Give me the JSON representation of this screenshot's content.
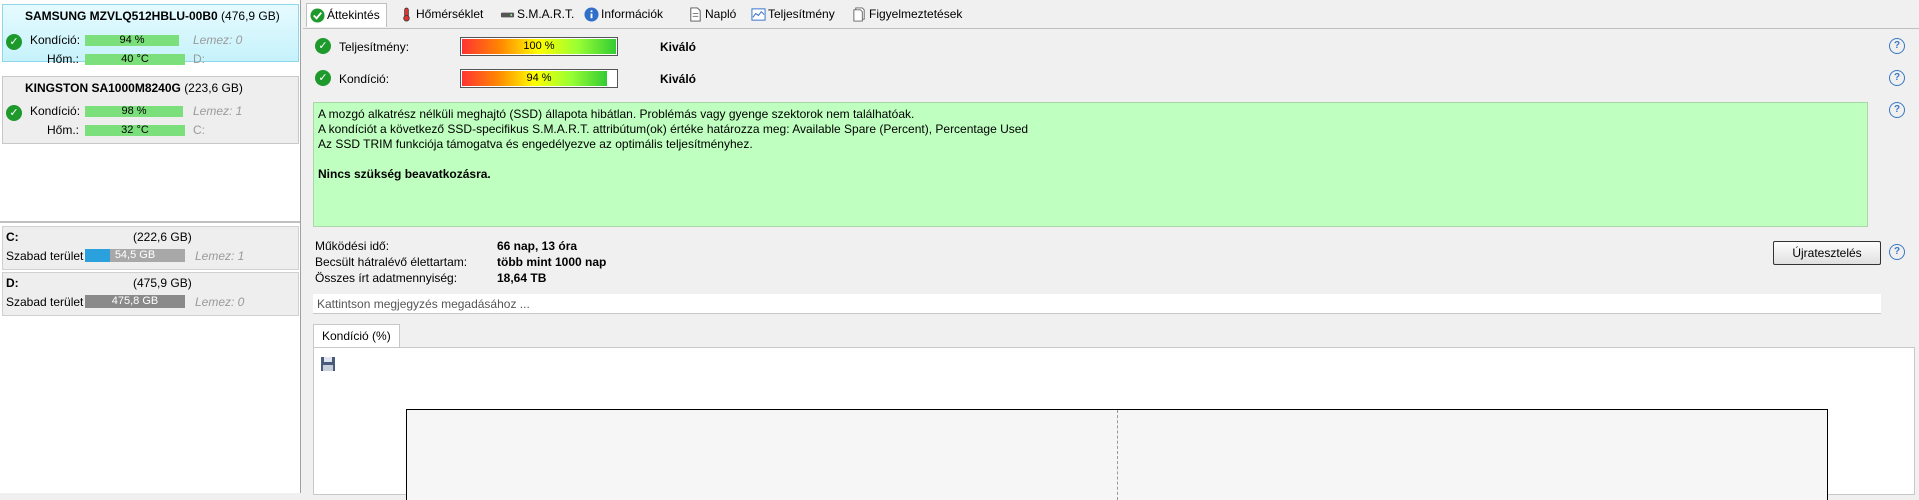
{
  "disks": [
    {
      "name": "SAMSUNG MZVLQ512HBLU-00B0",
      "size": "(476,9 GB)",
      "health_label": "Kondíció:",
      "health_value": "94 %",
      "health_fraction": 0.94,
      "temp_label": "Hőm.:",
      "temp_value": "40 °C",
      "partitions": "Lemez: 0",
      "letter": "D:"
    },
    {
      "name": "KINGSTON SA1000M8240G",
      "size": "(223,6 GB)",
      "health_label": "Kondíció:",
      "health_value": "98 %",
      "health_fraction": 0.98,
      "temp_label": "Hőm.:",
      "temp_value": "32 °C",
      "partitions": "Lemez: 1",
      "letter": "C:"
    }
  ],
  "volumes": [
    {
      "letter": "C:",
      "size": "(222,6 GB)",
      "free_label": "Szabad terület",
      "free_value": "54,5 GB",
      "free_fraction": 0.245,
      "disk": "Lemez: 1",
      "color": "#2aa0dc"
    },
    {
      "letter": "D:",
      "size": "(475,9 GB)",
      "free_label": "Szabad terület",
      "free_value": "475,8 GB",
      "free_fraction": 1.0,
      "disk": "Lemez: 0",
      "color": "#8a8a8a"
    }
  ],
  "tabs": [
    {
      "label": "Áttekintés",
      "icon": "check-icon"
    },
    {
      "label": "Hőmérséklet",
      "icon": "thermometer-icon"
    },
    {
      "label": "S.M.A.R.T.",
      "icon": "drive-icon"
    },
    {
      "label": "Információk",
      "icon": "info-icon"
    },
    {
      "label": "Napló",
      "icon": "document-icon"
    },
    {
      "label": "Teljesítmény",
      "icon": "chart-icon"
    },
    {
      "label": "Figyelmeztetések",
      "icon": "warnings-icon"
    }
  ],
  "performance": {
    "label": "Teljesítmény:",
    "value": "100 %",
    "fraction": 1.0,
    "status": "Kiváló"
  },
  "health": {
    "label": "Kondíció:",
    "value": "94 %",
    "fraction": 0.94,
    "status": "Kiváló"
  },
  "message": {
    "line1": "A mozgó alkatrész nélküli meghajtó (SSD) állapota hibátlan. Problémás vagy gyenge szektorok nem találhatóak.",
    "line2": "A kondíciót a következő SSD-specifikus S.M.A.R.T. attribútum(ok) értéke határozza meg:  Available Spare (Percent), Percentage Used",
    "line3": "Az SSD TRIM funkciója támogatva és engedélyezve az optimális teljesítményhez.",
    "line4": "Nincs szükség beavatkozásra."
  },
  "info": {
    "uptime_label": "Működési idő:",
    "uptime_value": "66 nap, 13 óra",
    "remaining_label": "Becsült hátralévő élettartam:",
    "remaining_value": "több mint 1000 nap",
    "written_label": "Összes írt adatmennyiség:",
    "written_value": "18,64 TB"
  },
  "retest_label": "Újratesztelés",
  "note_placeholder": "Kattintson megjegyzés megadásához ...",
  "chart_tab_label": "Kondíció  (%)",
  "colors": {
    "selected_disk": "#c6f2fb",
    "ok_green": "#1e9a2c",
    "message_bg": "#bfffbf",
    "accent": "#3a78c2"
  }
}
